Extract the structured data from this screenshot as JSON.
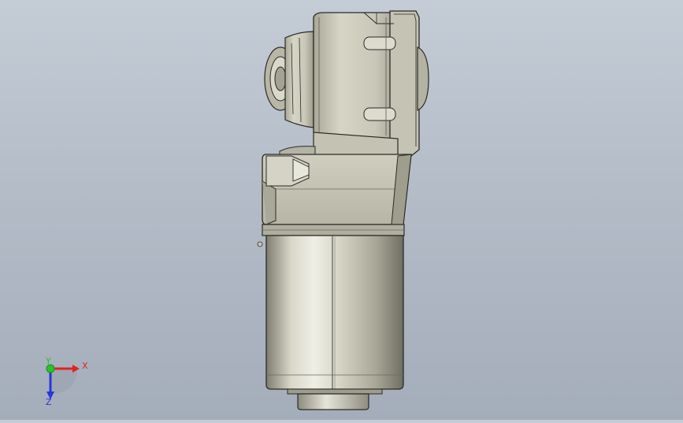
{
  "viewport": {
    "background_top": "#c4ccd6",
    "background_bottom": "#a4adba",
    "model": {
      "part_color": "#c9c8b7",
      "edge_color": "#2a2a26",
      "shade_color": "#8f8e80",
      "highlight_color": "#efeee4"
    },
    "triad": {
      "x_label": "X",
      "y_label": "Y",
      "z_label": "Z",
      "x_color": "#e0231c",
      "y_color": "#27c427",
      "z_color": "#2437d8"
    }
  }
}
